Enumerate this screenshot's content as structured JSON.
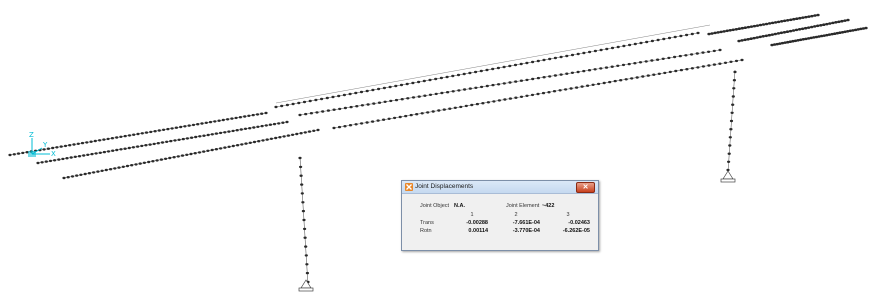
{
  "axis": {
    "z_label": "Z",
    "x_label": "X",
    "y_label": "Y"
  },
  "dialog": {
    "title": "Joint Displacements",
    "close_symbol": "✕",
    "joint_object_label": "Joint Object",
    "joint_object_value": "N.A.",
    "joint_element_label": "Joint Element",
    "joint_element_value": "~422",
    "col_headers": [
      "1",
      "2",
      "3"
    ],
    "rows": [
      {
        "label": "Trans",
        "values": [
          "-0.00288",
          "-7.661E-04",
          "-0.02463"
        ]
      },
      {
        "label": "Rotn",
        "values": [
          "0.00114",
          "-3.770E-04",
          "-6.262E-05"
        ]
      }
    ]
  },
  "colors": {
    "joint": "#2a2a2a",
    "frame": "#555555",
    "axis": "#00bcd4",
    "dialog_close": "#c8401d"
  },
  "icons": [
    "axis-triad-icon",
    "joint-dot-icon",
    "support-icon",
    "app-logo-icon",
    "close-icon"
  ]
}
